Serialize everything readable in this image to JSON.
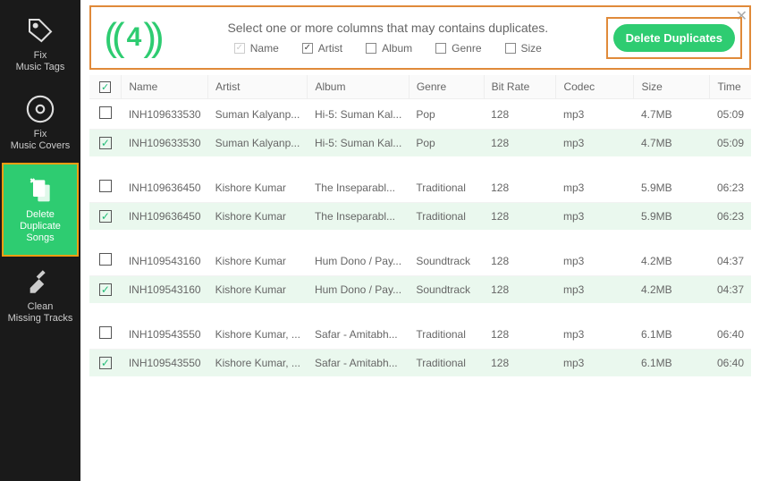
{
  "sidebar": {
    "items": [
      {
        "label": "Fix\nMusic Tags",
        "icon": "tag-icon"
      },
      {
        "label": "Fix\nMusic Covers",
        "icon": "disc-icon"
      },
      {
        "label": "Delete\nDuplicate Songs",
        "icon": "duplicate-icon"
      },
      {
        "label": "Clean\nMissing Tracks",
        "icon": "broom-icon"
      }
    ],
    "active_index": 2
  },
  "header": {
    "count": "4",
    "instruction": "Select one or more columns that may contains duplicates.",
    "filters": [
      {
        "label": "Name",
        "checked": true,
        "disabled": true
      },
      {
        "label": "Artist",
        "checked": true,
        "disabled": false
      },
      {
        "label": "Album",
        "checked": false,
        "disabled": false
      },
      {
        "label": "Genre",
        "checked": false,
        "disabled": false
      },
      {
        "label": "Size",
        "checked": false,
        "disabled": false
      }
    ],
    "delete_button": "Delete Duplicates"
  },
  "table": {
    "columns": [
      "Name",
      "Artist",
      "Album",
      "Genre",
      "Bit Rate",
      "Codec",
      "Size",
      "Time"
    ],
    "groups": [
      {
        "rows": [
          {
            "selected": false,
            "cells": [
              "INH109633530",
              "Suman Kalyanp...",
              "Hi-5: Suman Kal...",
              "Pop",
              "128",
              "mp3",
              "4.7MB",
              "05:09"
            ]
          },
          {
            "selected": true,
            "cells": [
              "INH109633530",
              "Suman Kalyanp...",
              "Hi-5: Suman Kal...",
              "Pop",
              "128",
              "mp3",
              "4.7MB",
              "05:09"
            ]
          }
        ]
      },
      {
        "rows": [
          {
            "selected": false,
            "cells": [
              "INH109636450",
              "Kishore Kumar",
              "The Inseparabl...",
              "Traditional",
              "128",
              "mp3",
              "5.9MB",
              "06:23"
            ]
          },
          {
            "selected": true,
            "cells": [
              "INH109636450",
              "Kishore Kumar",
              "The Inseparabl...",
              "Traditional",
              "128",
              "mp3",
              "5.9MB",
              "06:23"
            ]
          }
        ]
      },
      {
        "rows": [
          {
            "selected": false,
            "cells": [
              "INH109543160",
              "Kishore Kumar",
              "Hum Dono / Pay...",
              "Soundtrack",
              "128",
              "mp3",
              "4.2MB",
              "04:37"
            ]
          },
          {
            "selected": true,
            "cells": [
              "INH109543160",
              "Kishore Kumar",
              "Hum Dono / Pay...",
              "Soundtrack",
              "128",
              "mp3",
              "4.2MB",
              "04:37"
            ]
          }
        ]
      },
      {
        "rows": [
          {
            "selected": false,
            "cells": [
              "INH109543550",
              "Kishore Kumar, ...",
              "Safar - Amitabh...",
              "Traditional",
              "128",
              "mp3",
              "6.1MB",
              "06:40"
            ]
          },
          {
            "selected": true,
            "cells": [
              "INH109543550",
              "Kishore Kumar, ...",
              "Safar - Amitabh...",
              "Traditional",
              "128",
              "mp3",
              "6.1MB",
              "06:40"
            ]
          }
        ]
      }
    ]
  }
}
